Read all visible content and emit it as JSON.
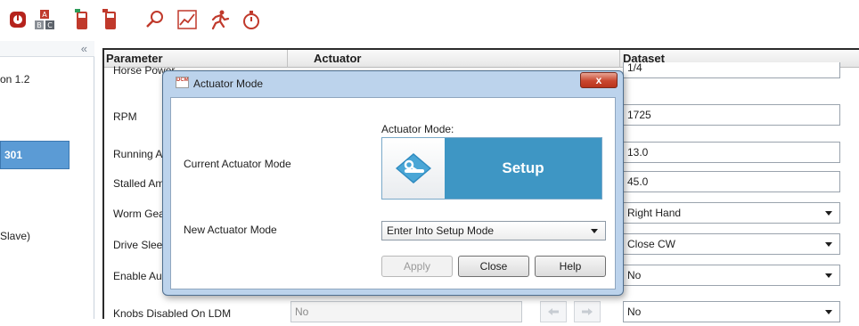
{
  "toolbar": {
    "buttons": [
      {
        "icon": "actuator-status-icon"
      },
      {
        "icon": "module-a-b-c-icon"
      },
      {
        "icon": "transmitter-connect-icon"
      },
      {
        "icon": "transmitter-disconnect-icon"
      },
      {
        "icon": "search-icon"
      },
      {
        "icon": "trend-chart-icon"
      },
      {
        "icon": "running-man-icon"
      },
      {
        "icon": "stopwatch-icon"
      }
    ]
  },
  "nav": {
    "collapse_glyph": "«",
    "line1": "on 1.2",
    "selected_item": "301",
    "line2": "Slave)"
  },
  "grid": {
    "headers": {
      "parameter": "Parameter",
      "actuator": "Actuator",
      "dataset": "Dataset"
    },
    "rows": [
      {
        "name": "Horse Power",
        "dataset": "1/4"
      },
      {
        "name": "RPM",
        "dataset": "1725"
      },
      {
        "name": "Running Amps",
        "dataset": "13.0"
      },
      {
        "name": "Stalled Amps",
        "dataset": "45.0"
      },
      {
        "name": "Worm Gear",
        "dataset": "Right Hand"
      },
      {
        "name": "Drive Sleeve",
        "dataset": "Close CW"
      },
      {
        "name": "Enable Aux",
        "dataset": "No"
      },
      {
        "name": "Knobs Disabled On LDM",
        "actuator": "No",
        "dataset": "No"
      }
    ]
  },
  "dialog": {
    "icon_text": "DCM",
    "title": "Actuator Mode",
    "close_glyph": "x",
    "current_label": "Current Actuator Mode",
    "mode_heading": "Actuator Mode:",
    "mode_value": "Setup",
    "new_label": "New Actuator Mode",
    "new_mode_selected": "Enter Into Setup Mode",
    "apply": "Apply",
    "close": "Close",
    "help": "Help"
  },
  "colors": {
    "accent_blue": "#3e96c4",
    "nav_selected": "#5b9bd5",
    "close_red": "#c9472f",
    "dialog_frame": "#bcd3ec"
  }
}
